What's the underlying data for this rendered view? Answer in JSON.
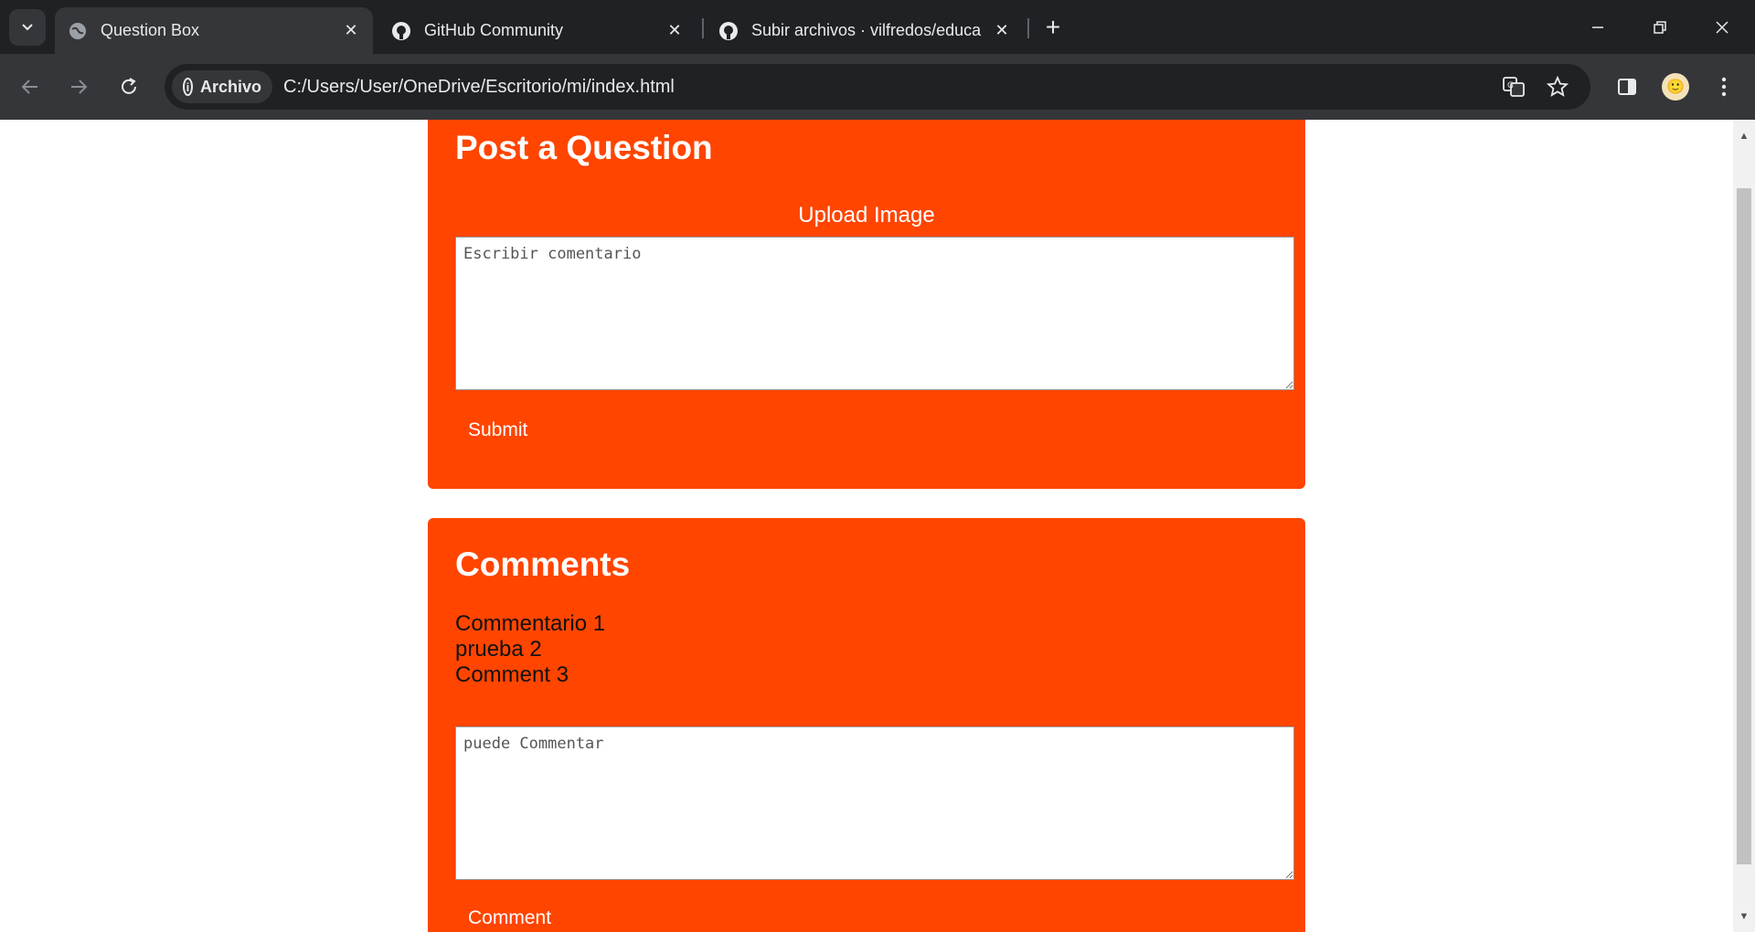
{
  "browser": {
    "tabs": [
      {
        "title": "Question Box",
        "icon": "globe-icon",
        "active": true
      },
      {
        "title": "GitHub Community",
        "icon": "github-icon",
        "active": false
      },
      {
        "title": "Subir archivos · vilfredos/educa",
        "icon": "github-icon",
        "active": false
      }
    ],
    "close_glyph": "✕",
    "newtab_glyph": "+",
    "site_chip": "Archivo",
    "url": "C:/Users/User/OneDrive/Escritorio/mi/index.html"
  },
  "question_card": {
    "title": "Post a Question",
    "upload_label": "Upload Image",
    "textarea_placeholder": "Escribir comentario",
    "submit_label": "Submit"
  },
  "comments_card": {
    "title": "Comments",
    "comments": [
      "Commentario 1",
      "prueba 2",
      "Comment 3"
    ],
    "textarea_placeholder": "puede Commentar",
    "comment_label": "Comment"
  },
  "colors": {
    "accent": "#ff4500",
    "chrome_dark": "#202124",
    "chrome_mid": "#35363a"
  }
}
